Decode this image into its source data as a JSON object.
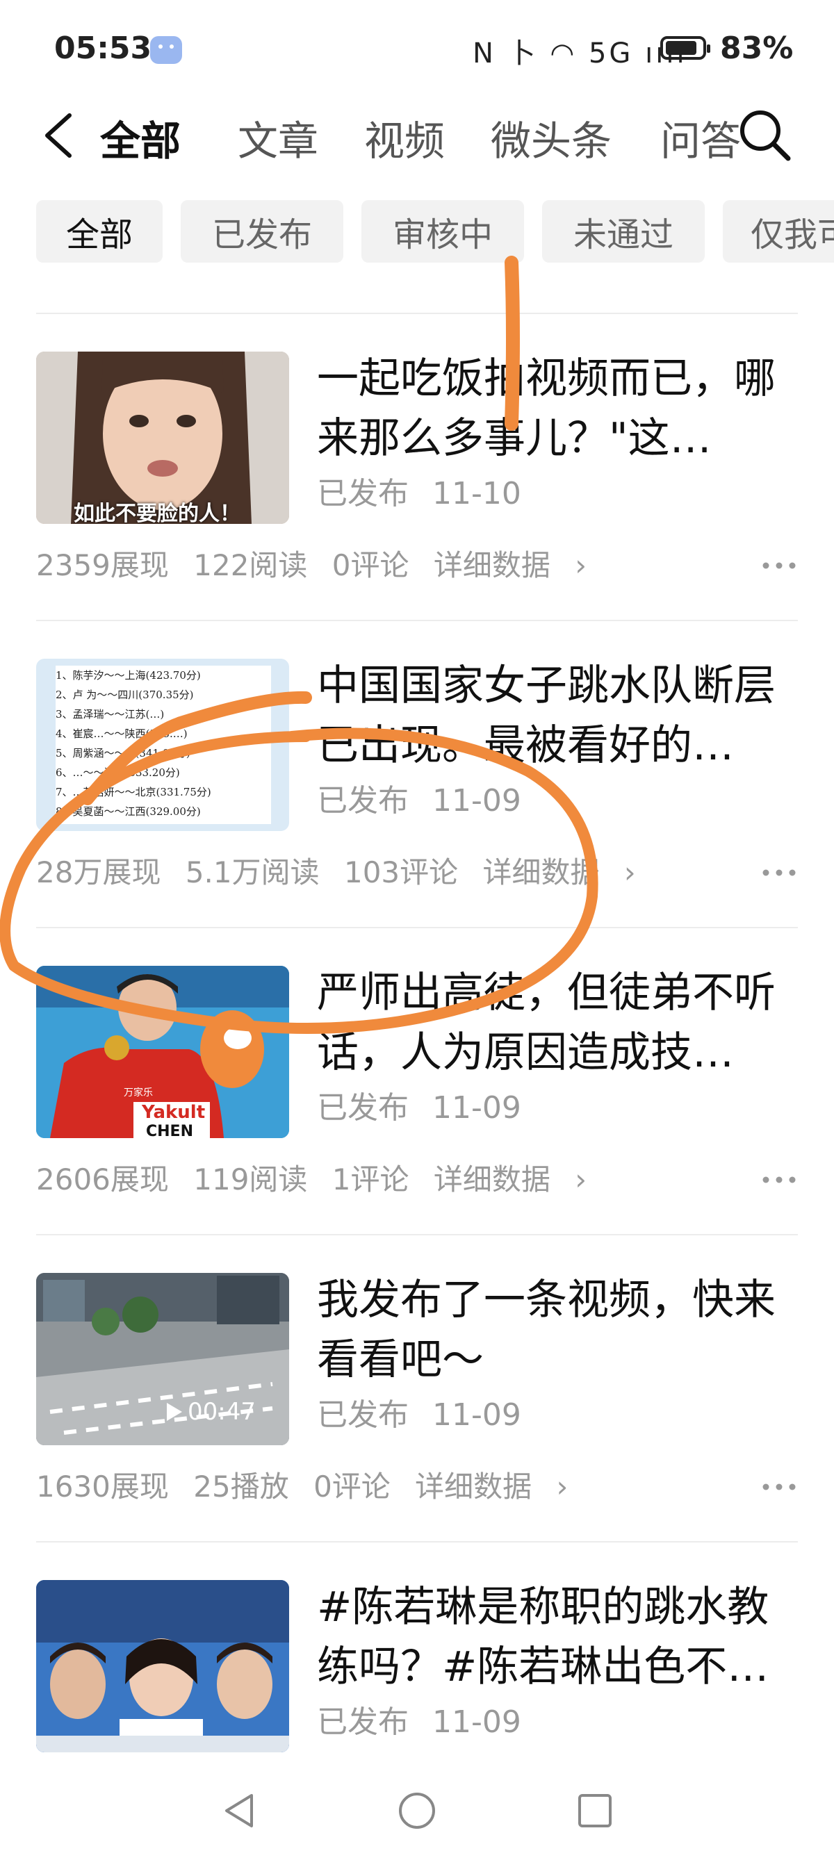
{
  "status_bar": {
    "time": "05:53",
    "icons_text": "N 卜 ◠ 5G ııll",
    "battery": "83%"
  },
  "nav": {
    "tabs": [
      {
        "label": "全部",
        "active": true
      },
      {
        "label": "文章",
        "active": false
      },
      {
        "label": "视频",
        "active": false
      },
      {
        "label": "微头条",
        "active": false
      },
      {
        "label": "问答",
        "active": false
      }
    ]
  },
  "filters": [
    {
      "label": "全部",
      "active": true
    },
    {
      "label": "已发布",
      "active": false
    },
    {
      "label": "审核中",
      "active": false
    },
    {
      "label": "未通过",
      "active": false
    },
    {
      "label": "仅我可见",
      "active": false
    }
  ],
  "items": [
    {
      "title": "一起吃饭拍视频而已，哪来那么多事儿？\"这…",
      "status": "已发布",
      "date": "11-10",
      "stats": [
        "2359展现",
        "122阅读",
        "0评论"
      ],
      "details": "详细数据",
      "thumb_caption": "如此不要脸的人！"
    },
    {
      "title": "中国国家女子跳水队断层已出现。最被看好的…",
      "status": "已发布",
      "date": "11-09",
      "stats": [
        "28万展现",
        "5.1万阅读",
        "103评论"
      ],
      "details": "详细数据",
      "ranking": [
        "1、陈芋汐～～上海(423.70分)",
        "2、卢 为～～四川(370.35分)",
        "3、孟泽瑞～～江苏(…)",
        "4、崔宸…～～陕西(355.…)",
        "5、周紫涵～～…(341.00分)",
        "6、…～～江苏(333.20分)",
        "7、…苑浩妍～～北京(331.75分)",
        "8、吴夏菡～～江西(329.00分)"
      ]
    },
    {
      "title": "严师出高徒，但徒弟不听话，人为原因造成技…",
      "status": "已发布",
      "date": "11-09",
      "stats": [
        "2606展现",
        "119阅读",
        "1评论"
      ],
      "details": "详细数据",
      "thumb_text": [
        "Yakult",
        "CHEN",
        "万家乐"
      ]
    },
    {
      "title": "我发布了一条视频，快来看看吧～",
      "status": "已发布",
      "date": "11-09",
      "stats": [
        "1630展现",
        "25播放",
        "0评论"
      ],
      "details": "详细数据",
      "duration": "00:47"
    },
    {
      "title": "#陈若琳是称职的跳水教练吗？#陈若琳出色不…",
      "status": "已发布",
      "date": "11-09",
      "stats": [],
      "details": ""
    }
  ],
  "colors": {
    "annotation": "#f08a3c",
    "chip_bg": "#f2f2f2",
    "muted_text": "#999999"
  }
}
